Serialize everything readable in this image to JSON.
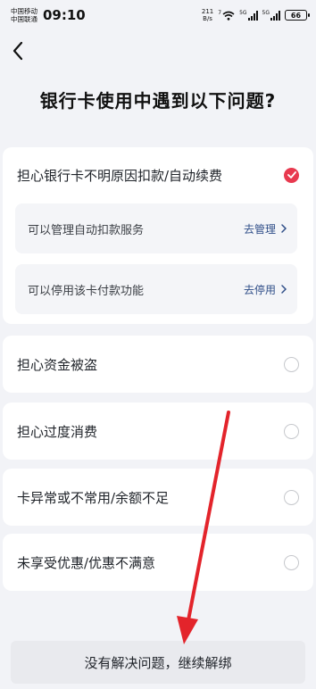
{
  "status_bar": {
    "carrier_1": "中国移动",
    "carrier_2": "中国联通",
    "time": "09:10",
    "net_speed_value": "211",
    "net_speed_unit": "B/s",
    "wifi_label": "7",
    "sig1_label": "5G",
    "sig2_label": "5G",
    "battery": "66"
  },
  "header": {
    "back_icon": "chevron-left-icon",
    "title": "银行卡使用中遇到以下问题?"
  },
  "options": [
    {
      "label": "担心银行卡不明原因扣款/自动续费",
      "selected": true,
      "sub_items": [
        {
          "label": "可以管理自动扣款服务",
          "action": "去管理"
        },
        {
          "label": "可以停用该卡付款功能",
          "action": "去停用"
        }
      ]
    },
    {
      "label": "担心资金被盗",
      "selected": false
    },
    {
      "label": "担心过度消费",
      "selected": false
    },
    {
      "label": "卡异常或不常用/余额不足",
      "selected": false
    },
    {
      "label": "未享受优惠/优惠不满意",
      "selected": false
    }
  ],
  "footer": {
    "continue_label": "没有解决问题，继续解绑"
  },
  "colors": {
    "accent_red": "#e8394f",
    "link_blue": "#2f4e88",
    "background": "#f2f3f7"
  }
}
